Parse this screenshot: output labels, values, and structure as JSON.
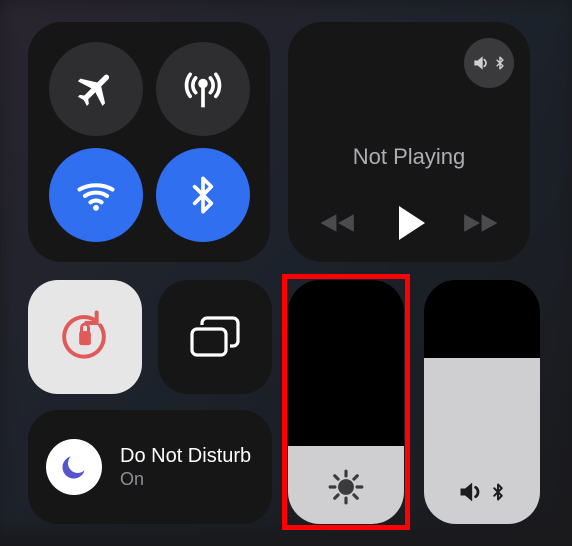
{
  "connectivity": {
    "airplane": {
      "on": false
    },
    "cellular": {
      "on": false
    },
    "wifi": {
      "on": true
    },
    "bluetooth": {
      "on": true
    }
  },
  "media": {
    "status_label": "Not Playing",
    "output_device": "bluetooth-speaker"
  },
  "orientation_lock": {
    "on": false
  },
  "screen_mirroring": {
    "active": false
  },
  "focus": {
    "title": "Do Not Disturb",
    "state_label": "On"
  },
  "brightness": {
    "percent": 32
  },
  "volume": {
    "percent": 68,
    "output": "bluetooth"
  },
  "annotation": {
    "highlight_target": "brightness-slider",
    "color": "#ff0000"
  }
}
